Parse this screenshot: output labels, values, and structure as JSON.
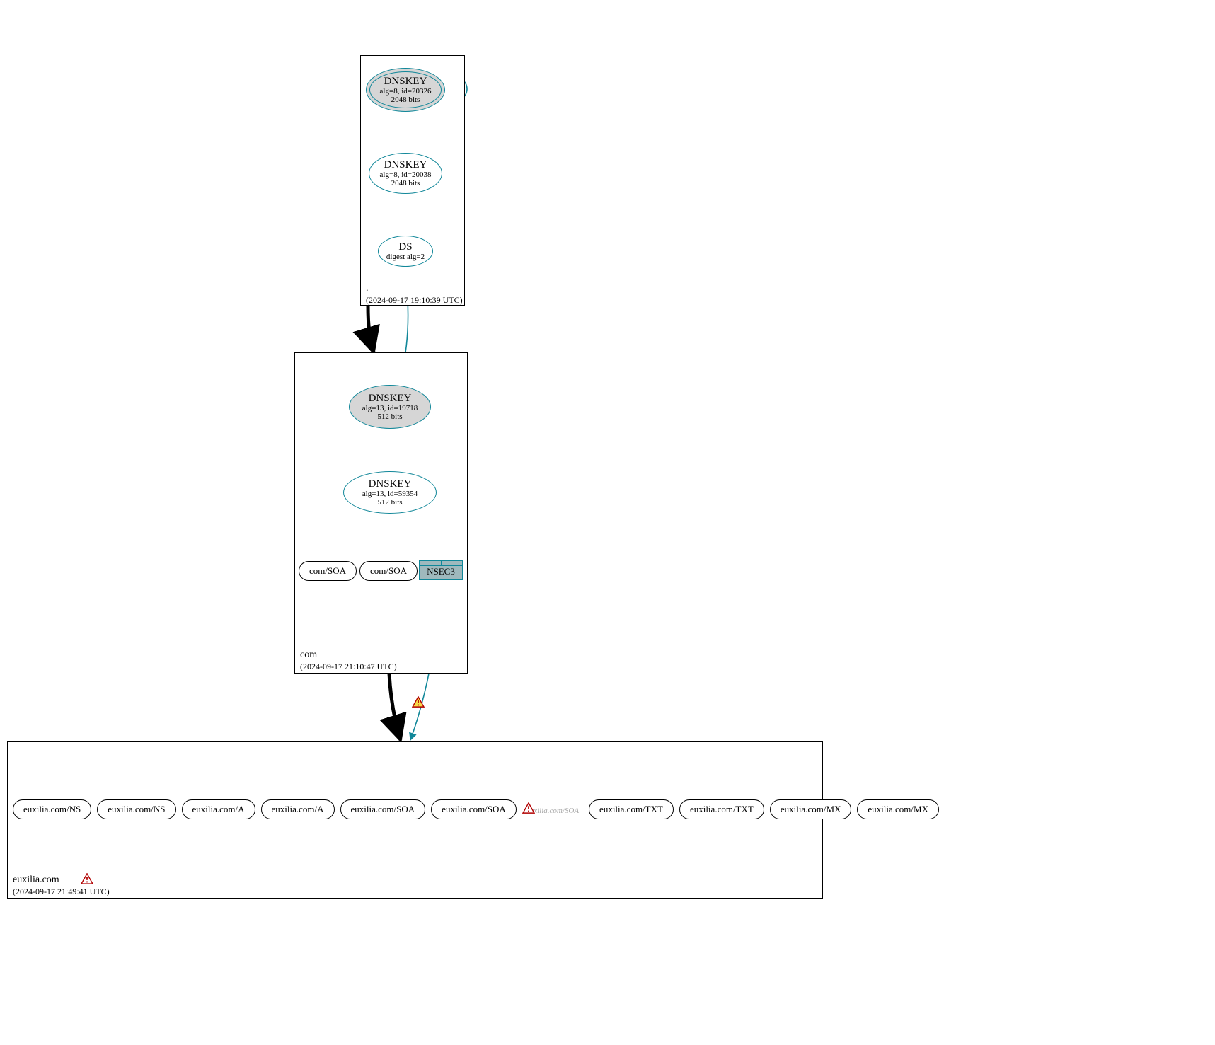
{
  "colors": {
    "teal": "#118799",
    "black": "#000000",
    "nodeFill": "#d6d6d6"
  },
  "zones": {
    "root": {
      "name": ".",
      "timestamp": "(2024-09-17 19:10:39 UTC)"
    },
    "com": {
      "name": "com",
      "timestamp": "(2024-09-17 21:10:47 UTC)"
    },
    "leaf": {
      "name": "euxilia.com",
      "timestamp": "(2024-09-17 21:49:41 UTC)"
    }
  },
  "nodes": {
    "root_key1": {
      "title": "DNSKEY",
      "line2": "alg=8, id=20326",
      "line3": "2048 bits"
    },
    "root_key2": {
      "title": "DNSKEY",
      "line2": "alg=8, id=20038",
      "line3": "2048 bits"
    },
    "root_ds": {
      "title": "DS",
      "line2": "digest alg=2"
    },
    "com_key1": {
      "title": "DNSKEY",
      "line2": "alg=13, id=19718",
      "line3": "512 bits"
    },
    "com_key2": {
      "title": "DNSKEY",
      "line2": "alg=13, id=59354",
      "line3": "512 bits"
    },
    "com_soa1": {
      "label": "com/SOA"
    },
    "com_soa2": {
      "label": "com/SOA"
    },
    "com_nsec3": {
      "label": "NSEC3"
    },
    "leaf_items": [
      {
        "label": "euxilia.com/NS"
      },
      {
        "label": "euxilia.com/NS"
      },
      {
        "label": "euxilia.com/A"
      },
      {
        "label": "euxilia.com/A"
      },
      {
        "label": "euxilia.com/SOA"
      },
      {
        "label": "euxilia.com/SOA"
      },
      {
        "label": "euxilia.com/SOA",
        "inactive": true
      },
      {
        "label": "euxilia.com/TXT"
      },
      {
        "label": "euxilia.com/TXT"
      },
      {
        "label": "euxilia.com/MX"
      },
      {
        "label": "euxilia.com/MX"
      }
    ]
  }
}
